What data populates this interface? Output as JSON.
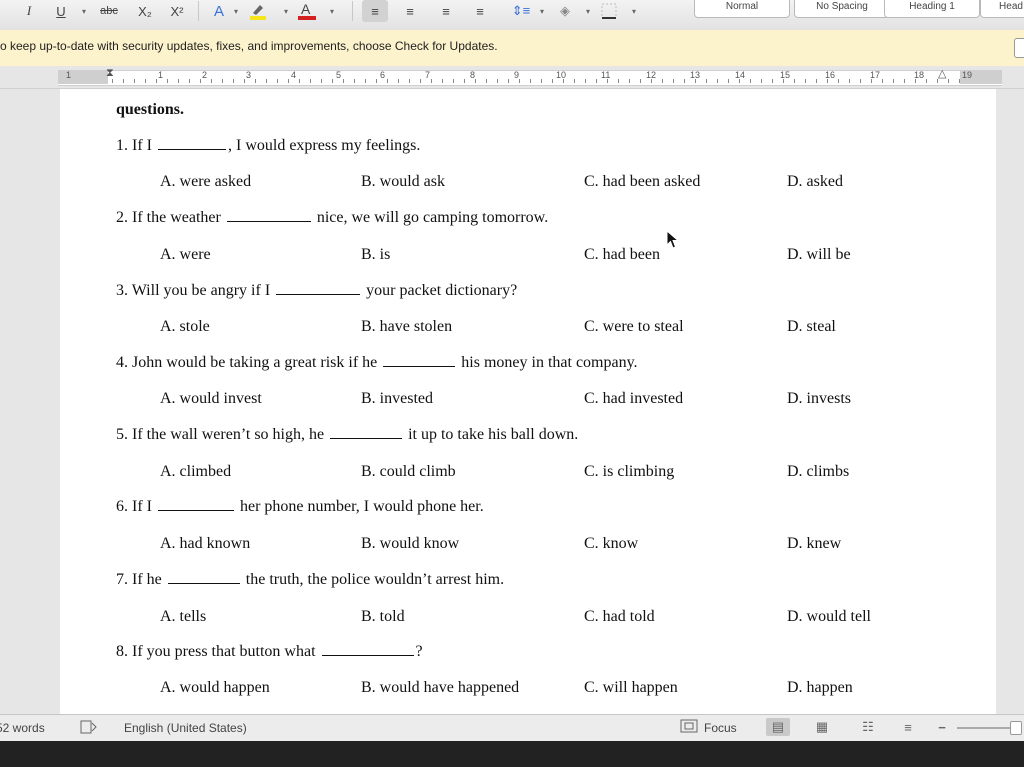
{
  "toolbar": {
    "buttons": [
      {
        "name": "italic-button",
        "glyph": "I"
      },
      {
        "name": "underline-button",
        "glyph": "U"
      },
      {
        "name": "strikethrough-button",
        "glyph": "abc"
      },
      {
        "name": "subscript-button",
        "glyph": "X₂"
      },
      {
        "name": "superscript-button",
        "glyph": "X²"
      }
    ],
    "styles": [
      "Normal",
      "No Spacing",
      "Heading 1",
      "Head"
    ],
    "colors": {
      "highlight": "#f5e51a",
      "font": "#d42020",
      "accent": "#3a6fd8"
    }
  },
  "message_bar": {
    "text": "o keep up-to-date with security updates, fixes, and improvements, choose Check for Updates."
  },
  "ruler": {
    "numbers": [
      "1",
      "1",
      "2",
      "3",
      "4",
      "5",
      "6",
      "7",
      "8",
      "9",
      "10",
      "11",
      "12",
      "13",
      "14",
      "15",
      "16",
      "17",
      "18",
      "19"
    ]
  },
  "document": {
    "heading": "questions.",
    "questions": [
      {
        "prefix": "1. If I",
        "suffix": ", I would express my feelings.",
        "options": [
          "A. were asked",
          "B. would ask",
          "C. had been asked",
          "D. asked"
        ]
      },
      {
        "prefix": "2. If the weather",
        "suffix": "nice, we will go camping tomorrow.",
        "options": [
          "A. were",
          "B. is",
          "C. had been",
          "D. will be"
        ]
      },
      {
        "prefix": "3. Will you be angry if I",
        "suffix": "your packet dictionary?",
        "options": [
          "A. stole",
          "B. have stolen",
          "C. were to steal",
          "D. steal"
        ]
      },
      {
        "prefix": "4. John would be taking a great risk if he",
        "suffix": "his money in that company.",
        "options": [
          "A. would invest",
          "B. invested",
          "C. had invested",
          "D. invests"
        ]
      },
      {
        "prefix": "5. If the wall weren’t so high, he",
        "suffix": "it up to take his ball down.",
        "options": [
          "A. climbed",
          "B. could climb",
          "C. is climbing",
          "D. climbs"
        ]
      },
      {
        "prefix": "6. If I",
        "suffix": "her phone number, I would phone her.",
        "options": [
          "A. had known",
          "B. would know",
          "C. know",
          "D. knew"
        ]
      },
      {
        "prefix": "7. If he",
        "suffix": "the truth, the police wouldn’t arrest him.",
        "options": [
          "A. tells",
          "B. told",
          "C. had told",
          "D. would tell"
        ]
      },
      {
        "prefix": "8. If you press that button what",
        "suffix": "?",
        "options": [
          "A. would happen",
          "B. would have happened",
          "C. will happen",
          "D. happen"
        ]
      }
    ]
  },
  "status_bar": {
    "word_count": "52 words",
    "language": "English (United States)",
    "focus": "Focus"
  }
}
